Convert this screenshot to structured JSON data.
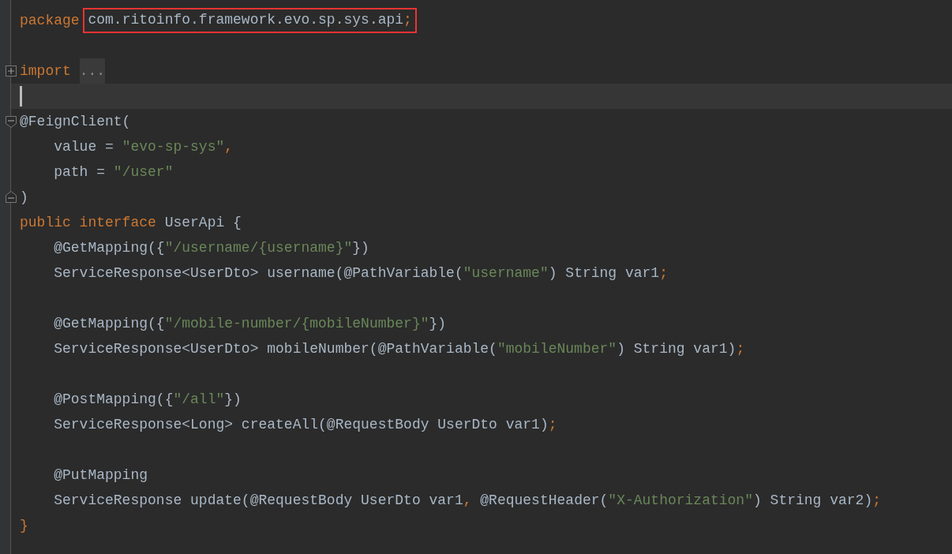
{
  "editor": {
    "lines": [
      {
        "kind": "code",
        "tokens": [
          {
            "kind": "keyword",
            "text": "package "
          },
          {
            "kind": "plain",
            "text": "com.ritoinfo.framework.evo.sp.sys.api",
            "boxed": true
          },
          {
            "kind": "punct",
            "text": ";",
            "boxed": true
          }
        ]
      },
      {
        "kind": "code"
      },
      {
        "kind": "collapsed",
        "tokens": [
          {
            "kind": "keyword",
            "text": "import "
          },
          {
            "kind": "folded",
            "text": "..."
          }
        ]
      },
      {
        "kind": "current"
      },
      {
        "kind": "foldstart",
        "tokens": [
          {
            "kind": "plain",
            "text": "@FeignClient("
          }
        ]
      },
      {
        "kind": "code",
        "tokens": [
          {
            "kind": "plain",
            "text": "    value = "
          },
          {
            "kind": "string",
            "text": "\"evo-sp-sys\""
          },
          {
            "kind": "punct",
            "text": ","
          }
        ]
      },
      {
        "kind": "code",
        "tokens": [
          {
            "kind": "plain",
            "text": "    path = "
          },
          {
            "kind": "string",
            "text": "\"/user\""
          }
        ]
      },
      {
        "kind": "foldend",
        "tokens": [
          {
            "kind": "plain",
            "text": ")"
          }
        ]
      },
      {
        "kind": "code",
        "tokens": [
          {
            "kind": "keyword",
            "text": "public interface "
          },
          {
            "kind": "plain",
            "text": "UserApi {"
          }
        ]
      },
      {
        "kind": "code",
        "tokens": [
          {
            "kind": "plain",
            "text": "    @GetMapping({"
          },
          {
            "kind": "string",
            "text": "\"/username/{username}\""
          },
          {
            "kind": "plain",
            "text": "})"
          }
        ]
      },
      {
        "kind": "code",
        "tokens": [
          {
            "kind": "plain",
            "text": "    ServiceResponse<UserDto> username(@PathVariable("
          },
          {
            "kind": "string",
            "text": "\"username\""
          },
          {
            "kind": "plain",
            "text": ") String var1"
          },
          {
            "kind": "punct",
            "text": ";"
          }
        ]
      },
      {
        "kind": "code"
      },
      {
        "kind": "code",
        "tokens": [
          {
            "kind": "plain",
            "text": "    @GetMapping({"
          },
          {
            "kind": "string",
            "text": "\"/mobile-number/{mobileNumber}\""
          },
          {
            "kind": "plain",
            "text": "})"
          }
        ]
      },
      {
        "kind": "code",
        "tokens": [
          {
            "kind": "plain",
            "text": "    ServiceResponse<UserDto> mobileNumber(@PathVariable("
          },
          {
            "kind": "string",
            "text": "\"mobileNumber\""
          },
          {
            "kind": "plain",
            "text": ") String var1)"
          },
          {
            "kind": "punct",
            "text": ";"
          }
        ]
      },
      {
        "kind": "code"
      },
      {
        "kind": "code",
        "tokens": [
          {
            "kind": "plain",
            "text": "    @PostMapping({"
          },
          {
            "kind": "string",
            "text": "\"/all\""
          },
          {
            "kind": "plain",
            "text": "})"
          }
        ]
      },
      {
        "kind": "code",
        "tokens": [
          {
            "kind": "plain",
            "text": "    ServiceResponse<Long> createAll(@RequestBody UserDto var1)"
          },
          {
            "kind": "punct",
            "text": ";"
          }
        ]
      },
      {
        "kind": "code"
      },
      {
        "kind": "code",
        "tokens": [
          {
            "kind": "plain",
            "text": "    @PutMapping"
          }
        ]
      },
      {
        "kind": "code",
        "tokens": [
          {
            "kind": "plain",
            "text": "    ServiceResponse update(@RequestBody UserDto var1"
          },
          {
            "kind": "punct",
            "text": ", "
          },
          {
            "kind": "plain",
            "text": "@RequestHeader("
          },
          {
            "kind": "string",
            "text": "\"X-Authorization\""
          },
          {
            "kind": "plain",
            "text": ") String var2)"
          },
          {
            "kind": "punct",
            "text": ";"
          }
        ]
      },
      {
        "kind": "code",
        "tokens": [
          {
            "kind": "keyword",
            "text": "}"
          }
        ]
      }
    ]
  }
}
